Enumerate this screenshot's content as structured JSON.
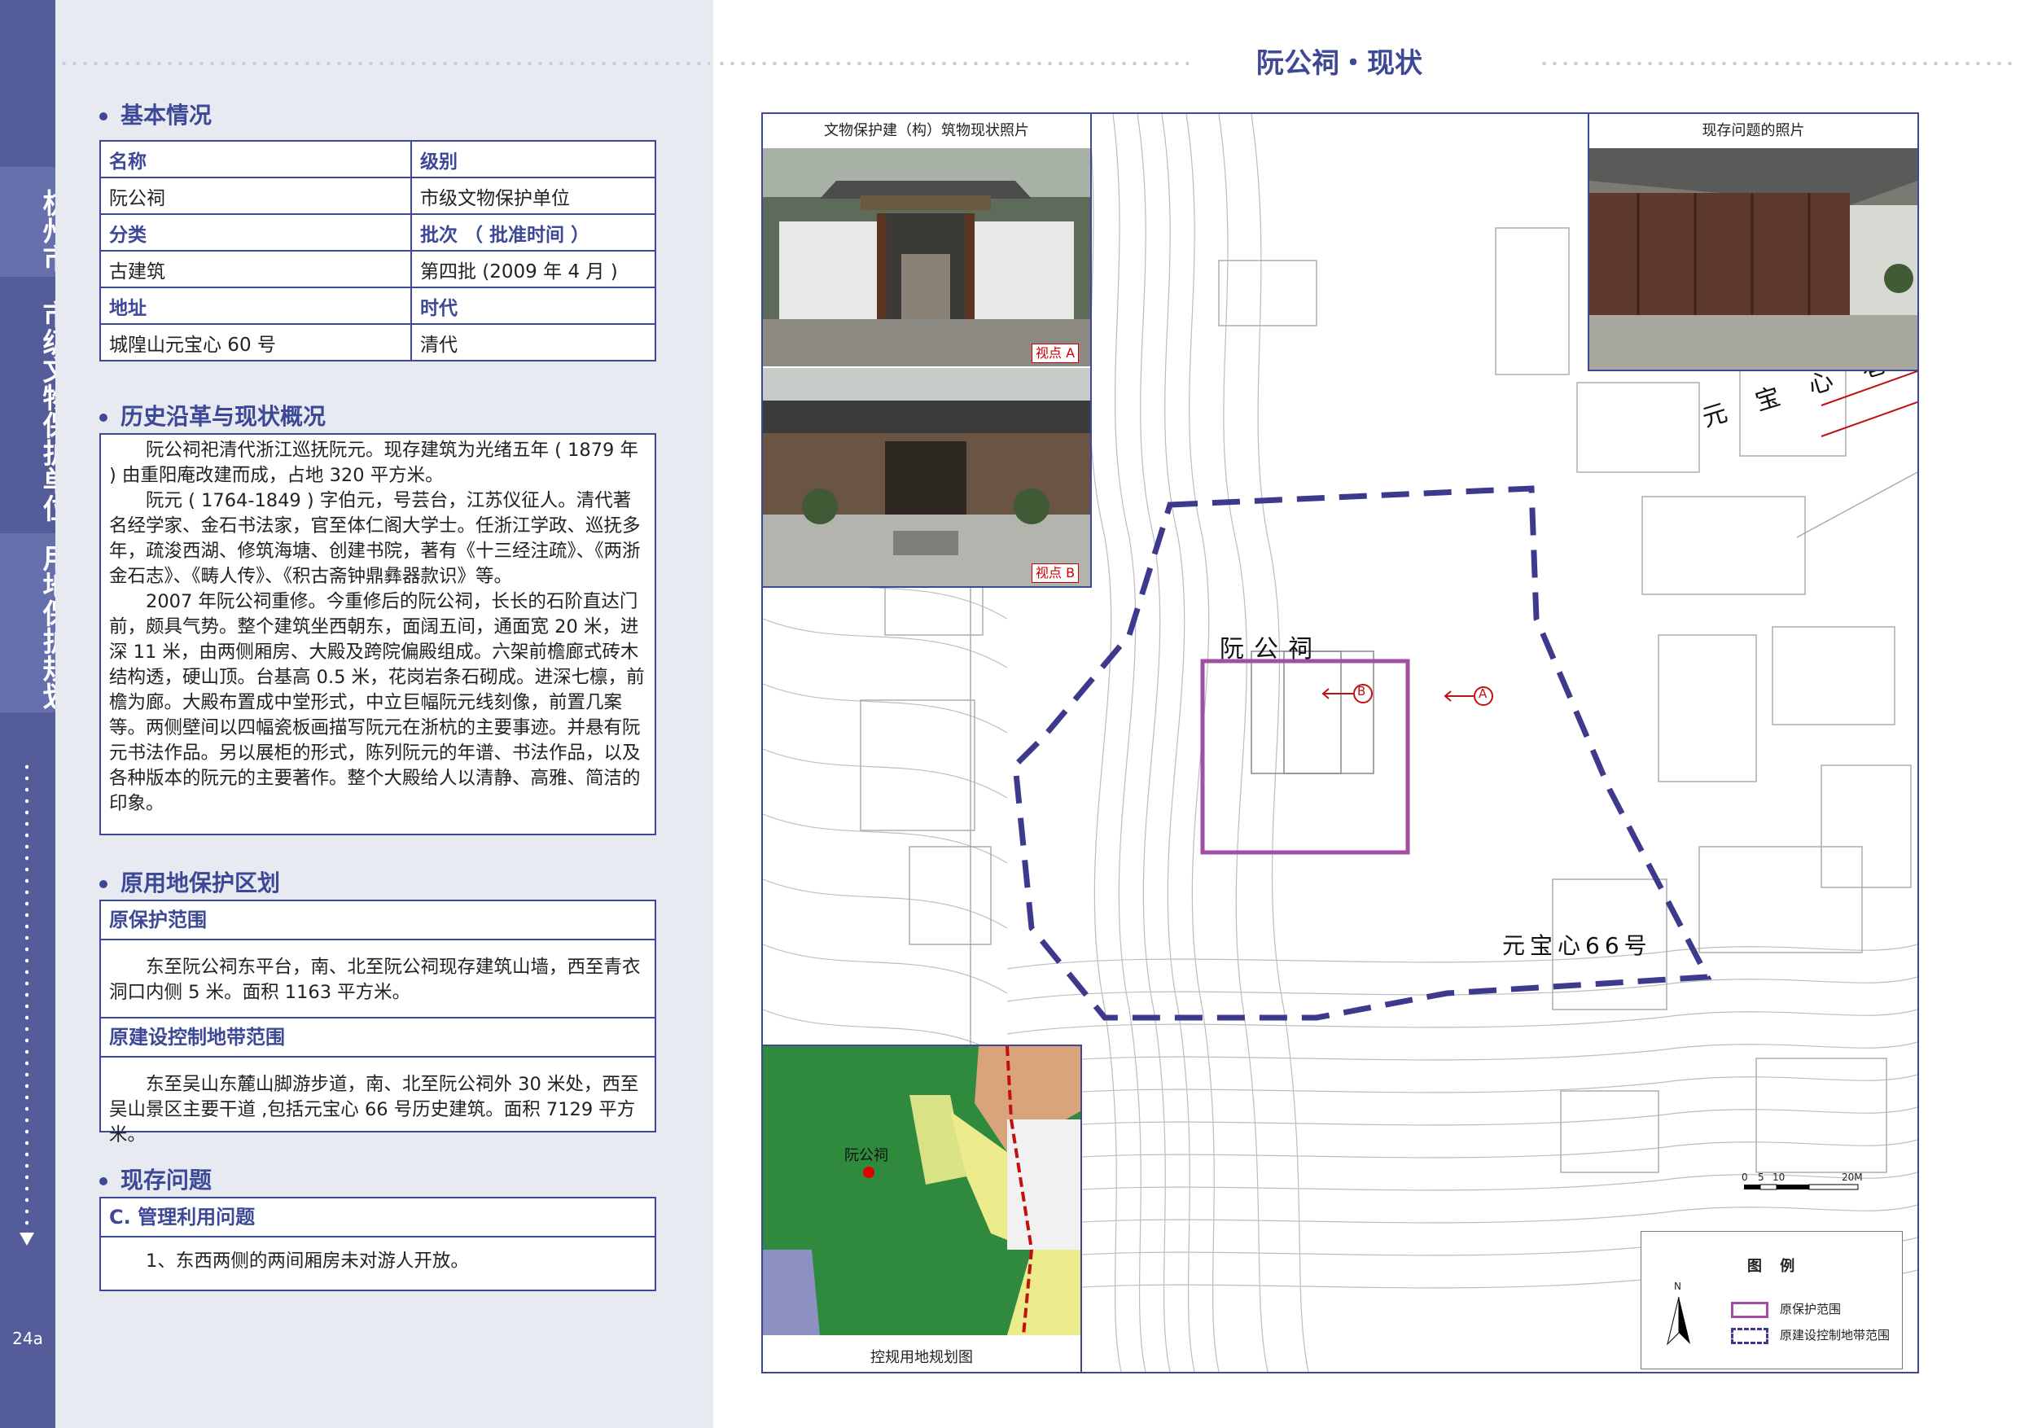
{
  "sidebar": {
    "city": "杭州市",
    "category": "市级文物保护单位",
    "section": "用地保护规划",
    "page_number": "24a"
  },
  "basic": {
    "title": "基本情况",
    "rows": [
      {
        "k1": "名称",
        "k2": "级别"
      },
      {
        "v1": "阮公祠",
        "v2": "市级文物保护单位"
      },
      {
        "k1": "分类",
        "k2": "批次 （ 批准时间 ）"
      },
      {
        "v1": "古建筑",
        "v2": "第四批 (2009 年 4 月 )"
      },
      {
        "k1": "地址",
        "k2": "时代"
      },
      {
        "v1": "城隍山元宝心 60 号",
        "v2": "清代"
      }
    ]
  },
  "history": {
    "title": "历史沿革与现状概况",
    "paragraphs": [
      "阮公祠祀清代浙江巡抚阮元。现存建筑为光绪五年 ( 1879 年 ) 由重阳庵改建而成，占地 320 平方米。",
      "阮元 ( 1764-1849 ) 字伯元，号芸台，江苏仪征人。清代著名经学家、金石书法家，官至体仁阁大学士。任浙江学政、巡抚多年，疏浚西湖、修筑海塘、创建书院，著有《十三经注疏》、《两浙金石志》、《畴人传》、《积古斋钟鼎彝器款识》等。",
      "2007 年阮公祠重修。今重修后的阮公祠，长长的石阶直达门前，颇具气势。整个建筑坐西朝东，面阔五间，通面宽 20 米，进深 11 米，由两侧厢房、大殿及跨院偏殿组成。六架前檐廊式砖木结构透，硬山顶。台基高 0.5 米，花岗岩条石砌成。进深七檩，前檐为廊。大殿布置成中堂形式，中立巨幅阮元线刻像，前置几案等。两侧壁间以四幅瓷板画描写阮元在浙杭的主要事迹。并悬有阮元书法作品。另以展柜的形式，陈列阮元的年谱、书法作品，以及各种版本的阮元的主要著作。整个大殿给人以清静、高雅、简洁的印象。"
    ]
  },
  "zoning": {
    "title": "原用地保护区划",
    "protect_title": "原保护范围",
    "protect_text": "东至阮公祠东平台，南、北至阮公祠现存建筑山墙，西至青衣洞口内侧 5 米。面积 1163 平方米。",
    "control_title": "原建设控制地带范围",
    "control_text": "东至吴山东麓山脚游步道，南、北至阮公祠外 30 米处，西至吴山景区主要干道 ,包括元宝心 66 号历史建筑。面积 7129 平方米。"
  },
  "issues": {
    "title": "现存问题",
    "sub_title": "C. 管理利用问题",
    "text": "1、东西两侧的两间厢房未对游人开放。"
  },
  "right": {
    "title": "阮公祠・现状",
    "photo_col_caption": "文物保护建（构）筑物现状照片",
    "view_a": "视点 A",
    "view_b": "视点 B",
    "issue_photo_caption": "现存问题的照片",
    "landuse_caption": "控规用地规划图",
    "landuse_site_label": "阮公祠",
    "map_label_site": "阮公祠",
    "map_label_street": "元宝心巷",
    "map_label_house": "元宝心66号",
    "marker_a": "A",
    "marker_b": "B",
    "legend_title": "图 例",
    "legend_item1": "原保护范围",
    "legend_item2": "原建设控制地带范围",
    "north": "N",
    "scale_labels": [
      "0",
      "5",
      "10",
      "20M"
    ],
    "colors": {
      "protect": "#a24ea3",
      "control": "#3d3a8e",
      "accent": "#3d4896"
    }
  }
}
